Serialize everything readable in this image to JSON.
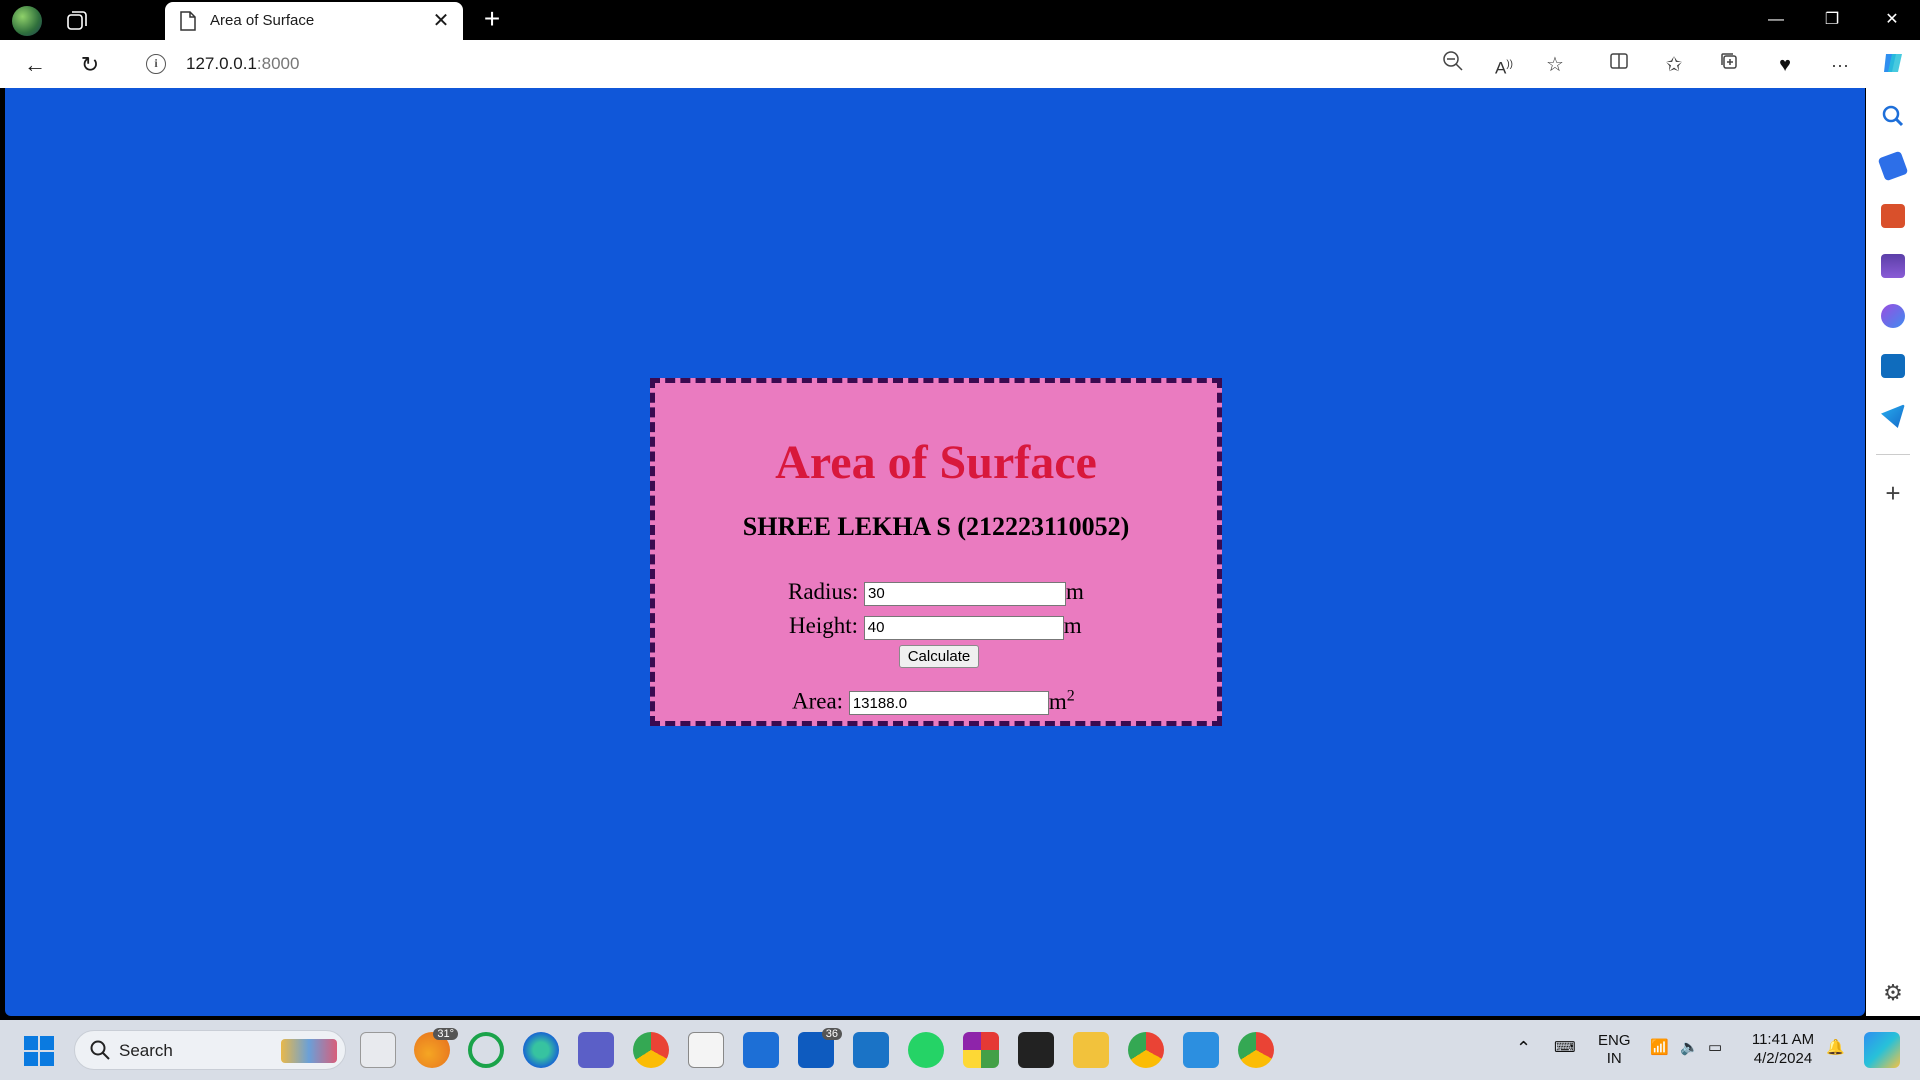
{
  "browser": {
    "tab_title": "Area of Surface",
    "url_host": "127.0.0.1",
    "url_port": ":8000"
  },
  "page": {
    "heading": "Area of Surface",
    "subheading": "SHREE LEKHA S (212223110052)",
    "radius_label": "Radius:",
    "radius_value": "30",
    "radius_unit": "m",
    "height_label": "Height:",
    "height_value": "40",
    "height_unit": "m",
    "calculate_label": "Calculate",
    "area_label": "Area:",
    "area_value": "13188.0",
    "area_unit": "m",
    "area_unit_exp": "2"
  },
  "taskbar": {
    "search_label": "Search",
    "weather_temp": "31°",
    "mail_badge": "36",
    "lang_top": "ENG",
    "lang_bottom": "IN",
    "time": "11:41 AM",
    "date": "4/2/2024"
  },
  "colors": {
    "page_bg": "#1057d9",
    "card_bg": "#ea7bc0",
    "heading": "#d8183c"
  }
}
